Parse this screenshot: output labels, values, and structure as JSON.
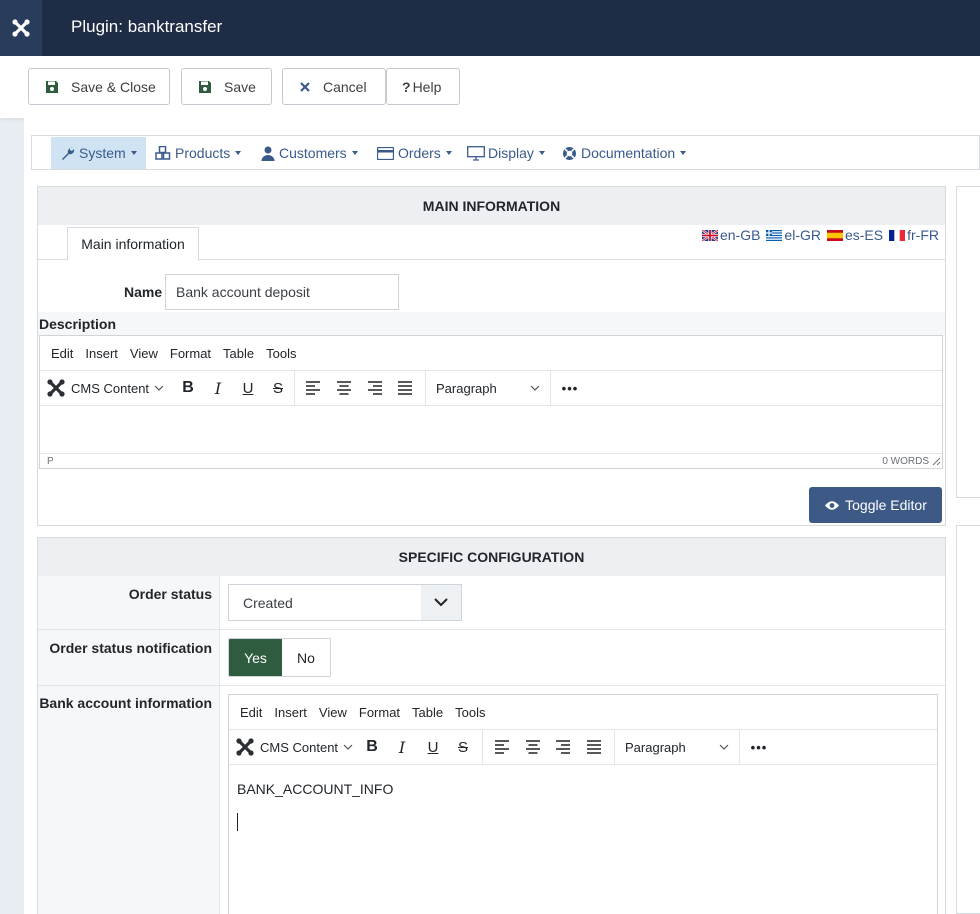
{
  "header": {
    "title": "Plugin: banktransfer"
  },
  "toolbar": {
    "save_close": "Save & Close",
    "save": "Save",
    "cancel": "Cancel",
    "help": "Help"
  },
  "menu": {
    "items": [
      {
        "label": "System",
        "icon": "wrench-icon"
      },
      {
        "label": "Products",
        "icon": "cubes-icon"
      },
      {
        "label": "Customers",
        "icon": "user-icon"
      },
      {
        "label": "Orders",
        "icon": "credit-card-icon"
      },
      {
        "label": "Display",
        "icon": "monitor-icon"
      },
      {
        "label": "Documentation",
        "icon": "lifering-icon"
      }
    ]
  },
  "main_info": {
    "title": "MAIN INFORMATION",
    "tab": "Main information",
    "languages": [
      "en-GB",
      "el-GR",
      "es-ES",
      "fr-FR"
    ],
    "name_label": "Name",
    "name_value": "Bank account deposit",
    "description_label": "Description",
    "toggle_editor": "Toggle Editor"
  },
  "editor": {
    "menus": [
      "Edit",
      "Insert",
      "View",
      "Format",
      "Table",
      "Tools"
    ],
    "cms_content": "CMS Content",
    "paragraph": "Paragraph",
    "path": "P",
    "words": "0 WORDS"
  },
  "specific": {
    "title": "SPECIFIC CONFIGURATION",
    "order_status_label": "Order status",
    "order_status_value": "Created",
    "notification_label": "Order status notification",
    "yes": "Yes",
    "no": "No",
    "bank_label": "Bank account information",
    "bank_content": "BANK_ACCOUNT_INFO"
  },
  "colors": {
    "topbar": "#1e2c46",
    "accent": "#3a5a8c",
    "yes_active": "#2f5c3f",
    "toggle": "#3d5a87"
  }
}
